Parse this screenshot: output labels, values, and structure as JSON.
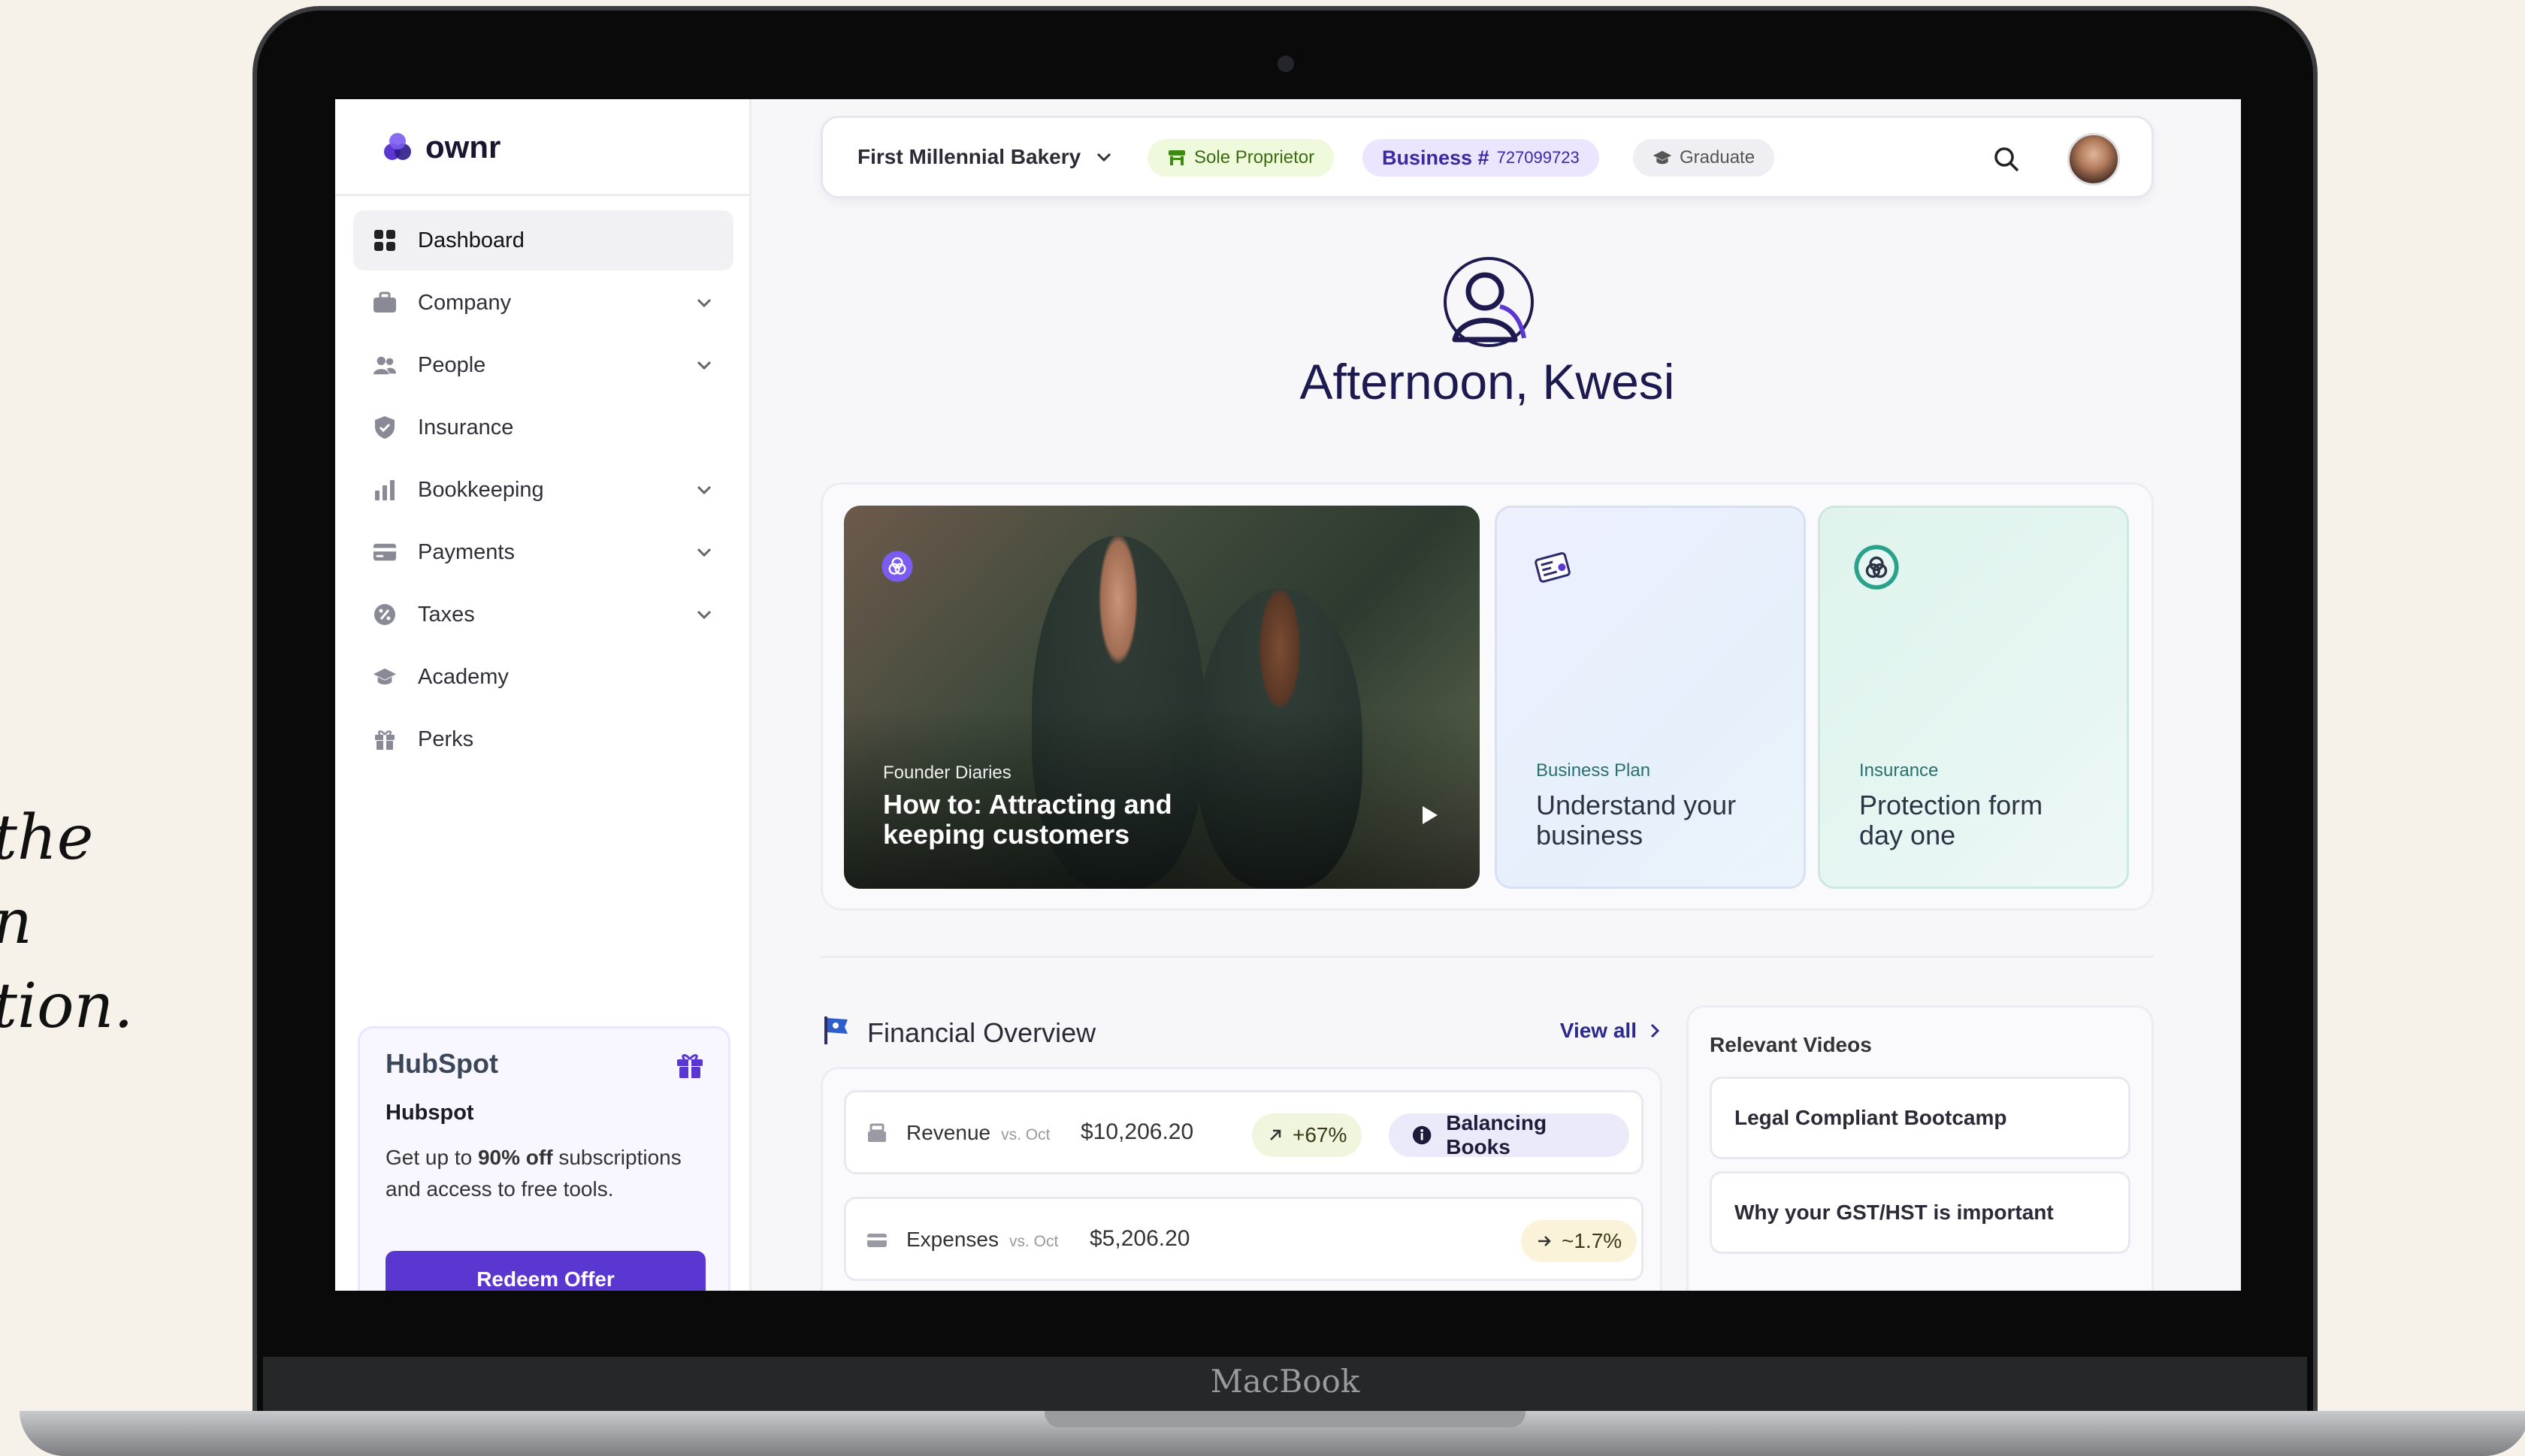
{
  "marketing": {
    "line1": "the",
    "line2": "n",
    "line3": "tion."
  },
  "device": {
    "brand": "MacBook"
  },
  "app": {
    "name": "ownr"
  },
  "sidebar": {
    "items": [
      {
        "label": "Dashboard"
      },
      {
        "label": "Company"
      },
      {
        "label": "People"
      },
      {
        "label": "Insurance"
      },
      {
        "label": "Bookkeeping"
      },
      {
        "label": "Payments"
      },
      {
        "label": "Taxes"
      },
      {
        "label": "Academy"
      },
      {
        "label": "Perks"
      }
    ],
    "promo": {
      "logo": "HubSpot",
      "name": "Hubspot",
      "desc_prefix": "Get up to ",
      "desc_bold": "90% off",
      "desc_suffix": " subscriptions and access to free tools.",
      "button": "Redeem Offer"
    }
  },
  "topbar": {
    "business_name": "First Millennial Bakery",
    "type_badge": "Sole Proprietor",
    "business_number_label": "Business #",
    "business_number": "727099723",
    "level_badge": "Graduate"
  },
  "greeting": "Afternoon, Kwesi",
  "cards": [
    {
      "tag": "Founder Diaries",
      "title_line1": "How to: Attracting and",
      "title_line2": "keeping customers"
    },
    {
      "tag": "Business Plan",
      "title_line1": "Understand your",
      "title_line2": "business"
    },
    {
      "tag": "Insurance",
      "title_line1": "Protection form",
      "title_line2": "day one"
    }
  ],
  "financial": {
    "title": "Financial Overview",
    "view_all": "View all",
    "rows": [
      {
        "label": "Revenue",
        "vs": "vs. Oct",
        "value": "$10,206.20",
        "change": "+67%"
      },
      {
        "label": "Expenses",
        "vs": "vs. Oct",
        "value": "$5,206.20",
        "change": "~1.7%"
      }
    ],
    "action": "Balancing Books"
  },
  "videos": {
    "title": "Relevant Videos",
    "items": [
      "Legal Compliant Bootcamp",
      "Why your GST/HST is important"
    ]
  },
  "colors": {
    "brand": "#5b37d1",
    "accent_navy": "#1d1a4f"
  }
}
